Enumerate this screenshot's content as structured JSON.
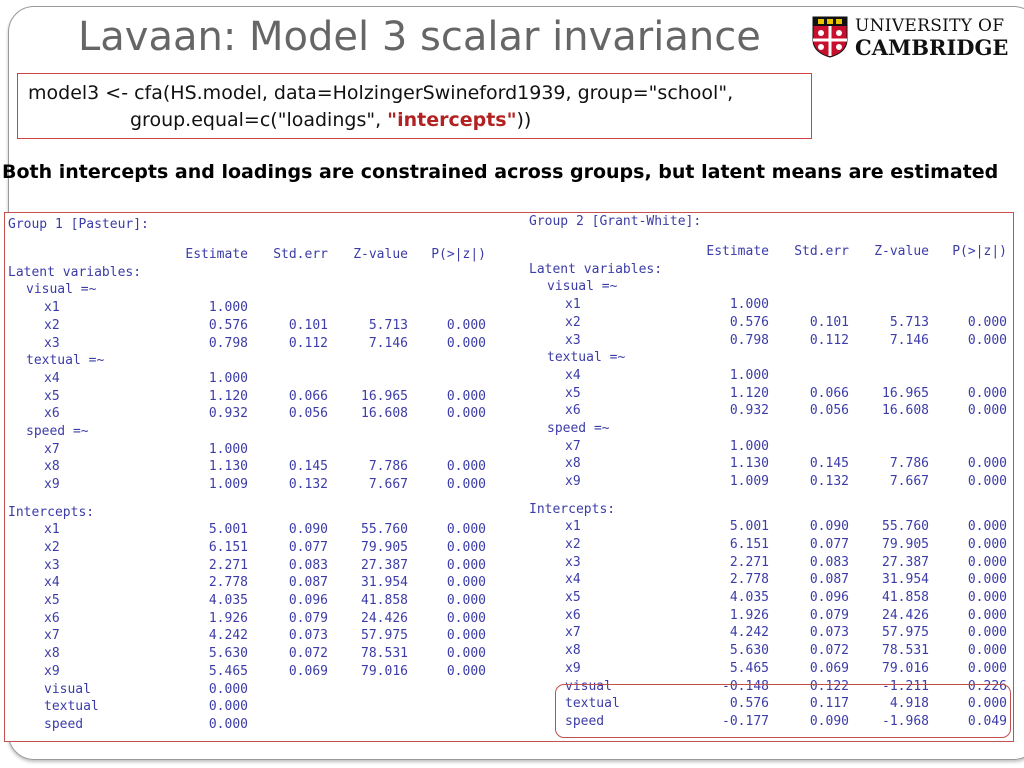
{
  "title": "Lavaan: Model 3 scalar invariance",
  "logo": {
    "line1": "UNIVERSITY OF",
    "line2": "CAMBRIDGE"
  },
  "code": {
    "line1": "model3 <- cfa(HS.model, data=HolzingerSwineford1939, group=\"school\",",
    "line2_pre": "group.equal=c(\"loadings\", ",
    "line2_hl": "\"intercepts\"",
    "line2_post": "))"
  },
  "note": "Both intercepts and loadings are constrained across groups, but latent means are estimated",
  "group1": {
    "header": "Group 1 [Pasteur]:",
    "columns": [
      "Estimate",
      "Std.err",
      "Z-value",
      "P(>|z|)"
    ],
    "latent_header": "Latent variables:",
    "latent_blocks": [
      {
        "name": "visual =~",
        "rows": [
          [
            "x1",
            "1.000",
            "",
            "",
            ""
          ],
          [
            "x2",
            "0.576",
            "0.101",
            "5.713",
            "0.000"
          ],
          [
            "x3",
            "0.798",
            "0.112",
            "7.146",
            "0.000"
          ]
        ]
      },
      {
        "name": "textual =~",
        "rows": [
          [
            "x4",
            "1.000",
            "",
            "",
            ""
          ],
          [
            "x5",
            "1.120",
            "0.066",
            "16.965",
            "0.000"
          ],
          [
            "x6",
            "0.932",
            "0.056",
            "16.608",
            "0.000"
          ]
        ]
      },
      {
        "name": "speed =~",
        "rows": [
          [
            "x7",
            "1.000",
            "",
            "",
            ""
          ],
          [
            "x8",
            "1.130",
            "0.145",
            "7.786",
            "0.000"
          ],
          [
            "x9",
            "1.009",
            "0.132",
            "7.667",
            "0.000"
          ]
        ]
      }
    ],
    "intercepts_header": "Intercepts:",
    "intercepts": [
      [
        "x1",
        "5.001",
        "0.090",
        "55.760",
        "0.000"
      ],
      [
        "x2",
        "6.151",
        "0.077",
        "79.905",
        "0.000"
      ],
      [
        "x3",
        "2.271",
        "0.083",
        "27.387",
        "0.000"
      ],
      [
        "x4",
        "2.778",
        "0.087",
        "31.954",
        "0.000"
      ],
      [
        "x5",
        "4.035",
        "0.096",
        "41.858",
        "0.000"
      ],
      [
        "x6",
        "1.926",
        "0.079",
        "24.426",
        "0.000"
      ],
      [
        "x7",
        "4.242",
        "0.073",
        "57.975",
        "0.000"
      ],
      [
        "x8",
        "5.630",
        "0.072",
        "78.531",
        "0.000"
      ],
      [
        "x9",
        "5.465",
        "0.069",
        "79.016",
        "0.000"
      ],
      [
        "visual",
        "0.000",
        "",
        "",
        ""
      ],
      [
        "textual",
        "0.000",
        "",
        "",
        ""
      ],
      [
        "speed",
        "0.000",
        "",
        "",
        ""
      ]
    ]
  },
  "group2": {
    "header": "Group 2 [Grant-White]:",
    "columns": [
      "Estimate",
      "Std.err",
      "Z-value",
      "P(>|z|)"
    ],
    "latent_header": "Latent variables:",
    "latent_blocks": [
      {
        "name": "visual =~",
        "rows": [
          [
            "x1",
            "1.000",
            "",
            "",
            ""
          ],
          [
            "x2",
            "0.576",
            "0.101",
            "5.713",
            "0.000"
          ],
          [
            "x3",
            "0.798",
            "0.112",
            "7.146",
            "0.000"
          ]
        ]
      },
      {
        "name": "textual =~",
        "rows": [
          [
            "x4",
            "1.000",
            "",
            "",
            ""
          ],
          [
            "x5",
            "1.120",
            "0.066",
            "16.965",
            "0.000"
          ],
          [
            "x6",
            "0.932",
            "0.056",
            "16.608",
            "0.000"
          ]
        ]
      },
      {
        "name": "speed =~",
        "rows": [
          [
            "x7",
            "1.000",
            "",
            "",
            ""
          ],
          [
            "x8",
            "1.130",
            "0.145",
            "7.786",
            "0.000"
          ],
          [
            "x9",
            "1.009",
            "0.132",
            "7.667",
            "0.000"
          ]
        ]
      }
    ],
    "intercepts_header": "Intercepts:",
    "intercepts": [
      [
        "x1",
        "5.001",
        "0.090",
        "55.760",
        "0.000"
      ],
      [
        "x2",
        "6.151",
        "0.077",
        "79.905",
        "0.000"
      ],
      [
        "x3",
        "2.271",
        "0.083",
        "27.387",
        "0.000"
      ],
      [
        "x4",
        "2.778",
        "0.087",
        "31.954",
        "0.000"
      ],
      [
        "x5",
        "4.035",
        "0.096",
        "41.858",
        "0.000"
      ],
      [
        "x6",
        "1.926",
        "0.079",
        "24.426",
        "0.000"
      ],
      [
        "x7",
        "4.242",
        "0.073",
        "57.975",
        "0.000"
      ],
      [
        "x8",
        "5.630",
        "0.072",
        "78.531",
        "0.000"
      ],
      [
        "x9",
        "5.465",
        "0.069",
        "79.016",
        "0.000"
      ],
      [
        "visual",
        "-0.148",
        "0.122",
        "-1.211",
        "0.226"
      ],
      [
        "textual",
        "0.576",
        "0.117",
        "4.918",
        "0.000"
      ],
      [
        "speed",
        "-0.177",
        "0.090",
        "-1.968",
        "0.049"
      ]
    ]
  }
}
